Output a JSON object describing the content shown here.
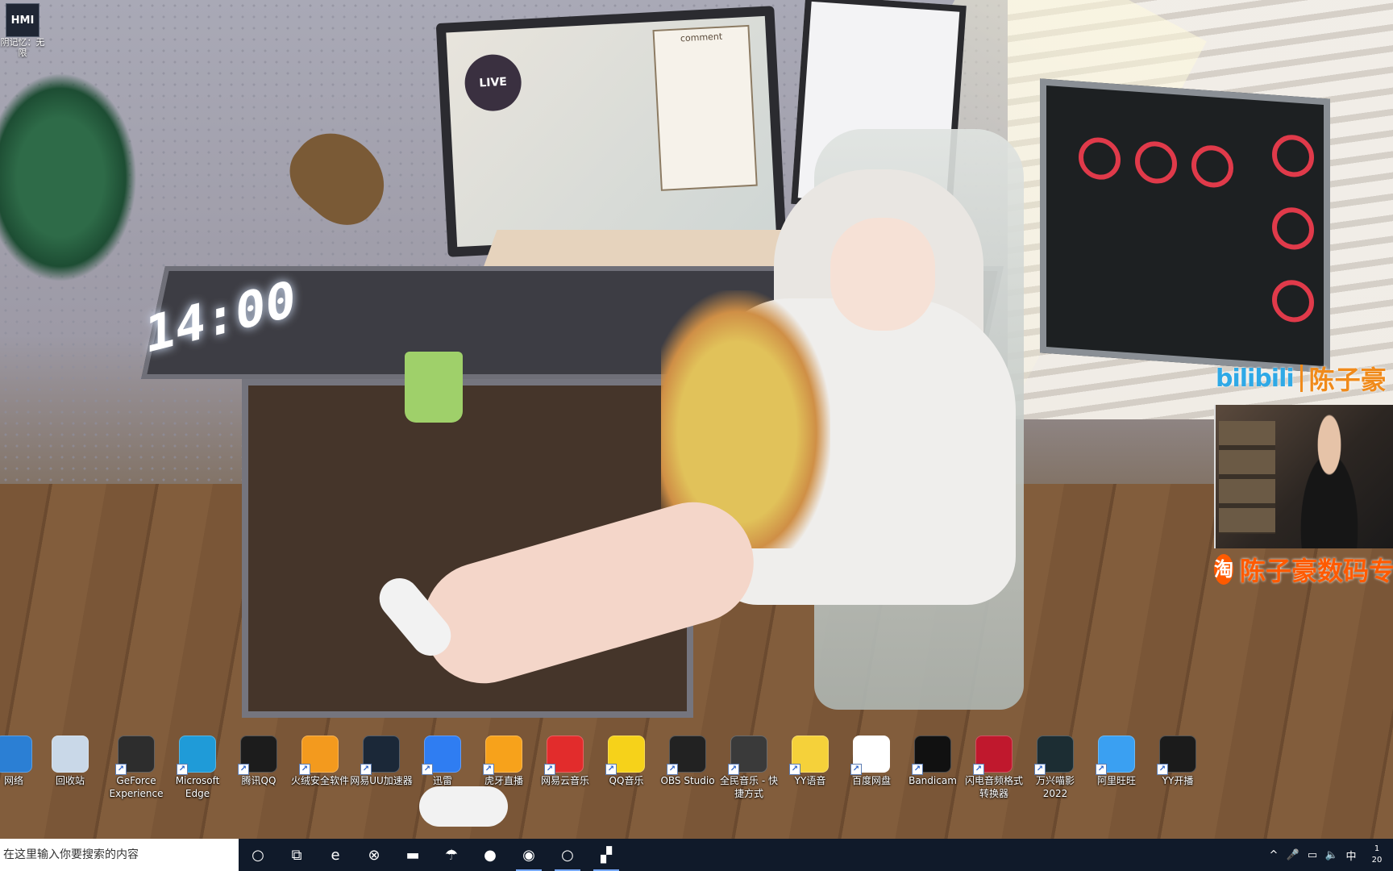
{
  "desktop": {
    "corner_icon": {
      "thumb_text": "HMI",
      "label": "阴记忆：无限"
    },
    "icons": [
      {
        "label": "网络",
        "icon": "network-icon",
        "color": "#2b7fd4",
        "shortcut": false
      },
      {
        "label": "回收站",
        "icon": "recycle-bin-icon",
        "color": "#c9d8e8",
        "shortcut": false
      },
      {
        "label": "GeForce Experience",
        "icon": "geforce-icon",
        "color": "#2d2d2d",
        "shortcut": true
      },
      {
        "label": "Microsoft Edge",
        "icon": "edge-icon",
        "color": "#1f9bd8",
        "shortcut": true
      },
      {
        "label": "腾讯QQ",
        "icon": "qq-icon",
        "color": "#1c1c1c",
        "shortcut": true
      },
      {
        "label": "火绒安全软件",
        "icon": "huorong-icon",
        "color": "#f39a1e",
        "shortcut": true
      },
      {
        "label": "网易UU加速器",
        "icon": "uu-accelerator-icon",
        "color": "#1b2838",
        "shortcut": true
      },
      {
        "label": "迅雷",
        "icon": "xunlei-icon",
        "color": "#2f7df2",
        "shortcut": true
      },
      {
        "label": "虎牙直播",
        "icon": "huya-icon",
        "color": "#f7a21b",
        "shortcut": true
      },
      {
        "label": "网易云音乐",
        "icon": "netease-music-icon",
        "color": "#e22c2c",
        "shortcut": true
      },
      {
        "label": "QQ音乐",
        "icon": "qq-music-icon",
        "color": "#f6d21a",
        "shortcut": true
      },
      {
        "label": "OBS Studio",
        "icon": "obs-icon",
        "color": "#222222",
        "shortcut": true
      },
      {
        "label": "全民音乐 - 快捷方式",
        "icon": "quanmin-music-icon",
        "color": "#3a3a3a",
        "shortcut": true
      },
      {
        "label": "YY语音",
        "icon": "yy-voice-icon",
        "color": "#f5d13a",
        "shortcut": true
      },
      {
        "label": "百度网盘",
        "icon": "baidu-netdisk-icon",
        "color": "#ffffff",
        "shortcut": true
      },
      {
        "label": "Bandicam",
        "icon": "bandicam-icon",
        "color": "#111111",
        "shortcut": true
      },
      {
        "label": "闪电音频格式转换器",
        "icon": "audio-converter-icon",
        "color": "#c0182d",
        "shortcut": true
      },
      {
        "label": "万兴喵影 2022",
        "icon": "filmora-icon",
        "color": "#1c2d33",
        "shortcut": true
      },
      {
        "label": "阿里旺旺",
        "icon": "aliwangwang-icon",
        "color": "#3aa0f2",
        "shortcut": true
      },
      {
        "label": "YY开播",
        "icon": "yy-live-icon",
        "color": "#1b1b1b",
        "shortcut": true
      }
    ]
  },
  "wallpaper": {
    "clock_text": "14:00",
    "monitor_label": "LIVE",
    "comment_label": "comment"
  },
  "overlay": {
    "bilibili_logo": "bilibili",
    "bilibili_name": "陈子豪",
    "taobao_badge": "淘",
    "taobao_name": "陈子豪数码专"
  },
  "taskbar": {
    "search_placeholder": "在这里输入你要搜索的内容",
    "apps": [
      {
        "name": "cortana-icon",
        "glyph": "○",
        "active": false
      },
      {
        "name": "task-view-icon",
        "glyph": "⧉",
        "active": false
      },
      {
        "name": "edge-icon",
        "glyph": "e",
        "active": false
      },
      {
        "name": "xbox-icon",
        "glyph": "⊗",
        "active": false
      },
      {
        "name": "file-explorer-icon",
        "glyph": "▬",
        "active": false
      },
      {
        "name": "app-pinned-icon",
        "glyph": "☂",
        "active": false
      },
      {
        "name": "huya-icon",
        "glyph": "●",
        "active": false
      },
      {
        "name": "obs-icon",
        "glyph": "◉",
        "active": true
      },
      {
        "name": "yy-live-icon",
        "glyph": "○",
        "active": true
      },
      {
        "name": "quanmin-music-icon",
        "glyph": "▞",
        "active": true
      }
    ],
    "tray": {
      "chevron": "^",
      "mic": "🎤",
      "network": "▭",
      "volume": "🔈",
      "ime": "中",
      "clock_line1": "1",
      "clock_line2": "20"
    }
  }
}
